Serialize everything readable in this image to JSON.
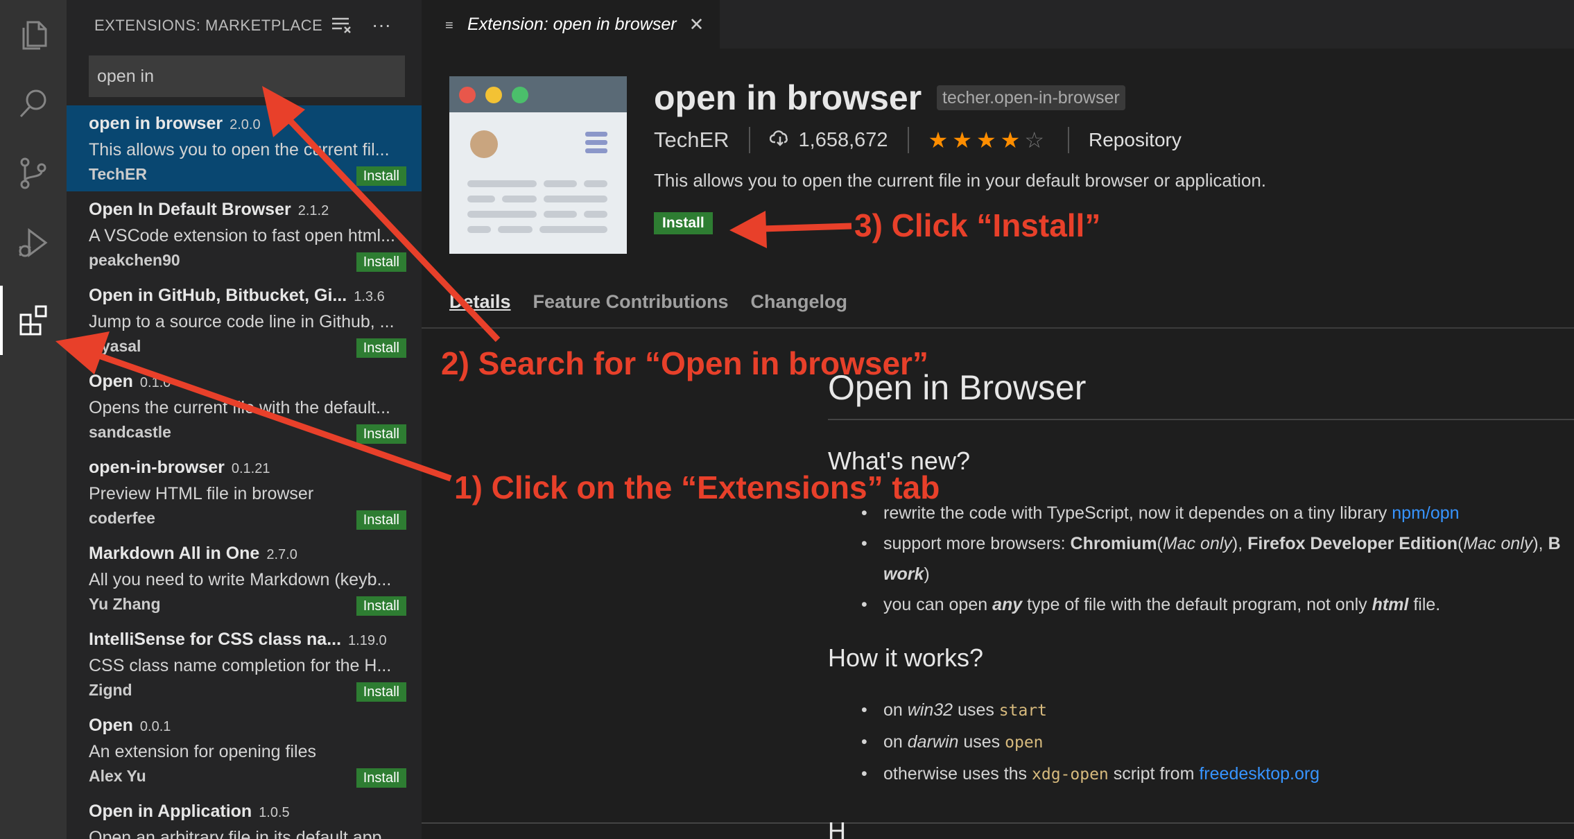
{
  "colors": {
    "accent_install": "#2e7d32",
    "selected_row": "#094771",
    "annotation": "#e8402a",
    "star": "#ff8e00",
    "link": "#3794ff"
  },
  "activity_bar": {
    "items": [
      {
        "icon": "files-icon"
      },
      {
        "icon": "search-icon"
      },
      {
        "icon": "source-control-icon"
      },
      {
        "icon": "run-debug-icon"
      },
      {
        "icon": "extensions-icon",
        "active": true
      }
    ]
  },
  "sidebar": {
    "title": "EXTENSIONS: MARKETPLACE",
    "search_value": "open in",
    "extensions": [
      {
        "name": "open in browser",
        "version": "2.0.0",
        "description": "This allows you to open the current fil...",
        "publisher": "TechER",
        "action": "Install"
      },
      {
        "name": "Open In Default Browser",
        "version": "2.1.2",
        "description": "A VSCode extension to fast open html...",
        "publisher": "peakchen90",
        "action": "Install"
      },
      {
        "name": "Open in GitHub, Bitbucket, Gi...",
        "version": "1.3.6",
        "description": "Jump to a source code line in Github, ...",
        "publisher": "ziyasal",
        "action": "Install"
      },
      {
        "name": "Open",
        "version": "0.1.0",
        "description": "Opens the current file with the default...",
        "publisher": "sandcastle",
        "action": "Install"
      },
      {
        "name": "open-in-browser",
        "version": "0.1.21",
        "description": "Preview HTML file in browser",
        "publisher": "coderfee",
        "action": "Install"
      },
      {
        "name": "Markdown All in One",
        "version": "2.7.0",
        "description": "All you need to write Markdown (keyb...",
        "publisher": "Yu Zhang",
        "action": "Install"
      },
      {
        "name": "IntelliSense for CSS class na...",
        "version": "1.19.0",
        "description": "CSS class name completion for the H...",
        "publisher": "Zignd",
        "action": "Install"
      },
      {
        "name": "Open",
        "version": "0.0.1",
        "description": "An extension for opening files",
        "publisher": "Alex Yu",
        "action": "Install"
      },
      {
        "name": "Open in Application",
        "version": "1.0.5",
        "description": "Open an arbitrary file in its default app...",
        "publisher": "",
        "action": ""
      }
    ]
  },
  "editor": {
    "tab_label": "Extension: open in browser",
    "title": "open in browser",
    "identifier": "techer.open-in-browser",
    "publisher": "TechER",
    "installs": "1,658,672",
    "rating": 3.5,
    "stars": "★★★★",
    "stars_empty": "☆",
    "repository": "Repository",
    "description": "This allows you to open the current file in your default browser or application.",
    "install_label": "Install",
    "tabs": [
      "Details",
      "Feature Contributions",
      "Changelog"
    ]
  },
  "readme": {
    "h1": "Open in Browser",
    "whats_new_title": "What's new?",
    "whats_new": {
      "item1_text": "rewrite the code with TypeScript, now it dependes on a tiny library ",
      "item1_link": "npm/opn",
      "item2_a": "support more browsers: ",
      "item2_b": "Chromium",
      "item2_c": "(",
      "item2_d": "Mac only",
      "item2_e": "), ",
      "item2_f": "Firefox Developer Edition",
      "item2_g": "(",
      "item2_h": "Mac only",
      "item2_i": "), ",
      "item2_j": "B",
      "item2_cont": "work",
      "item2_cont_tail": ")",
      "item3_a": "you can open ",
      "item3_b": "any",
      "item3_c": " type of file with the default program, not only ",
      "item3_d": "html",
      "item3_e": " file."
    },
    "how_title": "How it works?",
    "how": {
      "a_on": "on ",
      "a_os": "win32",
      "a_uses": " uses ",
      "a_cmd": "start",
      "b_on": "on ",
      "b_os": "darwin",
      "b_uses": " uses ",
      "b_cmd": "open",
      "c_pre": "otherwise uses ths ",
      "c_cmd": "xdg-open",
      "c_mid": " script from ",
      "c_link": "freedesktop.org"
    },
    "next_heading_peek": "H"
  },
  "annotations": {
    "step1": "1) Click on the “Extensions” tab",
    "step2": "2) Search for “Open in browser”",
    "step3": "3) Click “Install”"
  }
}
